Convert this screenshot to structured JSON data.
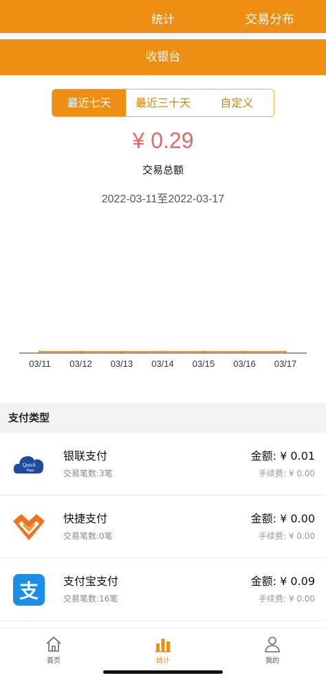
{
  "header": {
    "tab_stats": "统计",
    "tab_distribution": "交易分布"
  },
  "cashier": {
    "title": "收银台"
  },
  "range_tabs": [
    {
      "label": "最近七天",
      "active": true
    },
    {
      "label": "最近三十天",
      "active": false
    },
    {
      "label": "自定义",
      "active": false
    }
  ],
  "summary": {
    "amount": "¥ 0.29",
    "label": "交易总额",
    "date_range": "2022-03-11至2022-03-17"
  },
  "chart_data": {
    "type": "line",
    "categories": [
      "03/11",
      "03/12",
      "03/13",
      "03/14",
      "03/15",
      "03/16",
      "03/17"
    ],
    "series": [
      {
        "values": [
          0,
          0,
          0,
          0,
          0,
          0,
          0
        ]
      }
    ],
    "title": "",
    "xlabel": "",
    "ylabel": "",
    "grid": false,
    "colors": {
      "line": "#ee9a1c",
      "axis": "#333333"
    }
  },
  "payment_section": {
    "title": "支付类型",
    "items": [
      {
        "icon": "unionpay-quickpass-icon",
        "name": "银联支付",
        "count": "交易笔数:3笔",
        "amount": "金额: ¥ 0.01",
        "fee": "手续费: ¥ 0.00"
      },
      {
        "icon": "quick-pay-icon",
        "name": "快捷支付",
        "count": "交易笔数:0笔",
        "amount": "金额: ¥ 0.00",
        "fee": "手续费: ¥ 0.00"
      },
      {
        "icon": "alipay-icon",
        "name": "支付宝支付",
        "count": "交易笔数:16笔",
        "amount": "金额: ¥ 0.09",
        "fee": "手续费: ¥ 0.00"
      }
    ]
  },
  "bottom_nav": {
    "home": "首页",
    "stats": "统计",
    "mine": "我的"
  },
  "colors": {
    "accent": "#ee8e13",
    "amount_red": "#e26a6a"
  }
}
